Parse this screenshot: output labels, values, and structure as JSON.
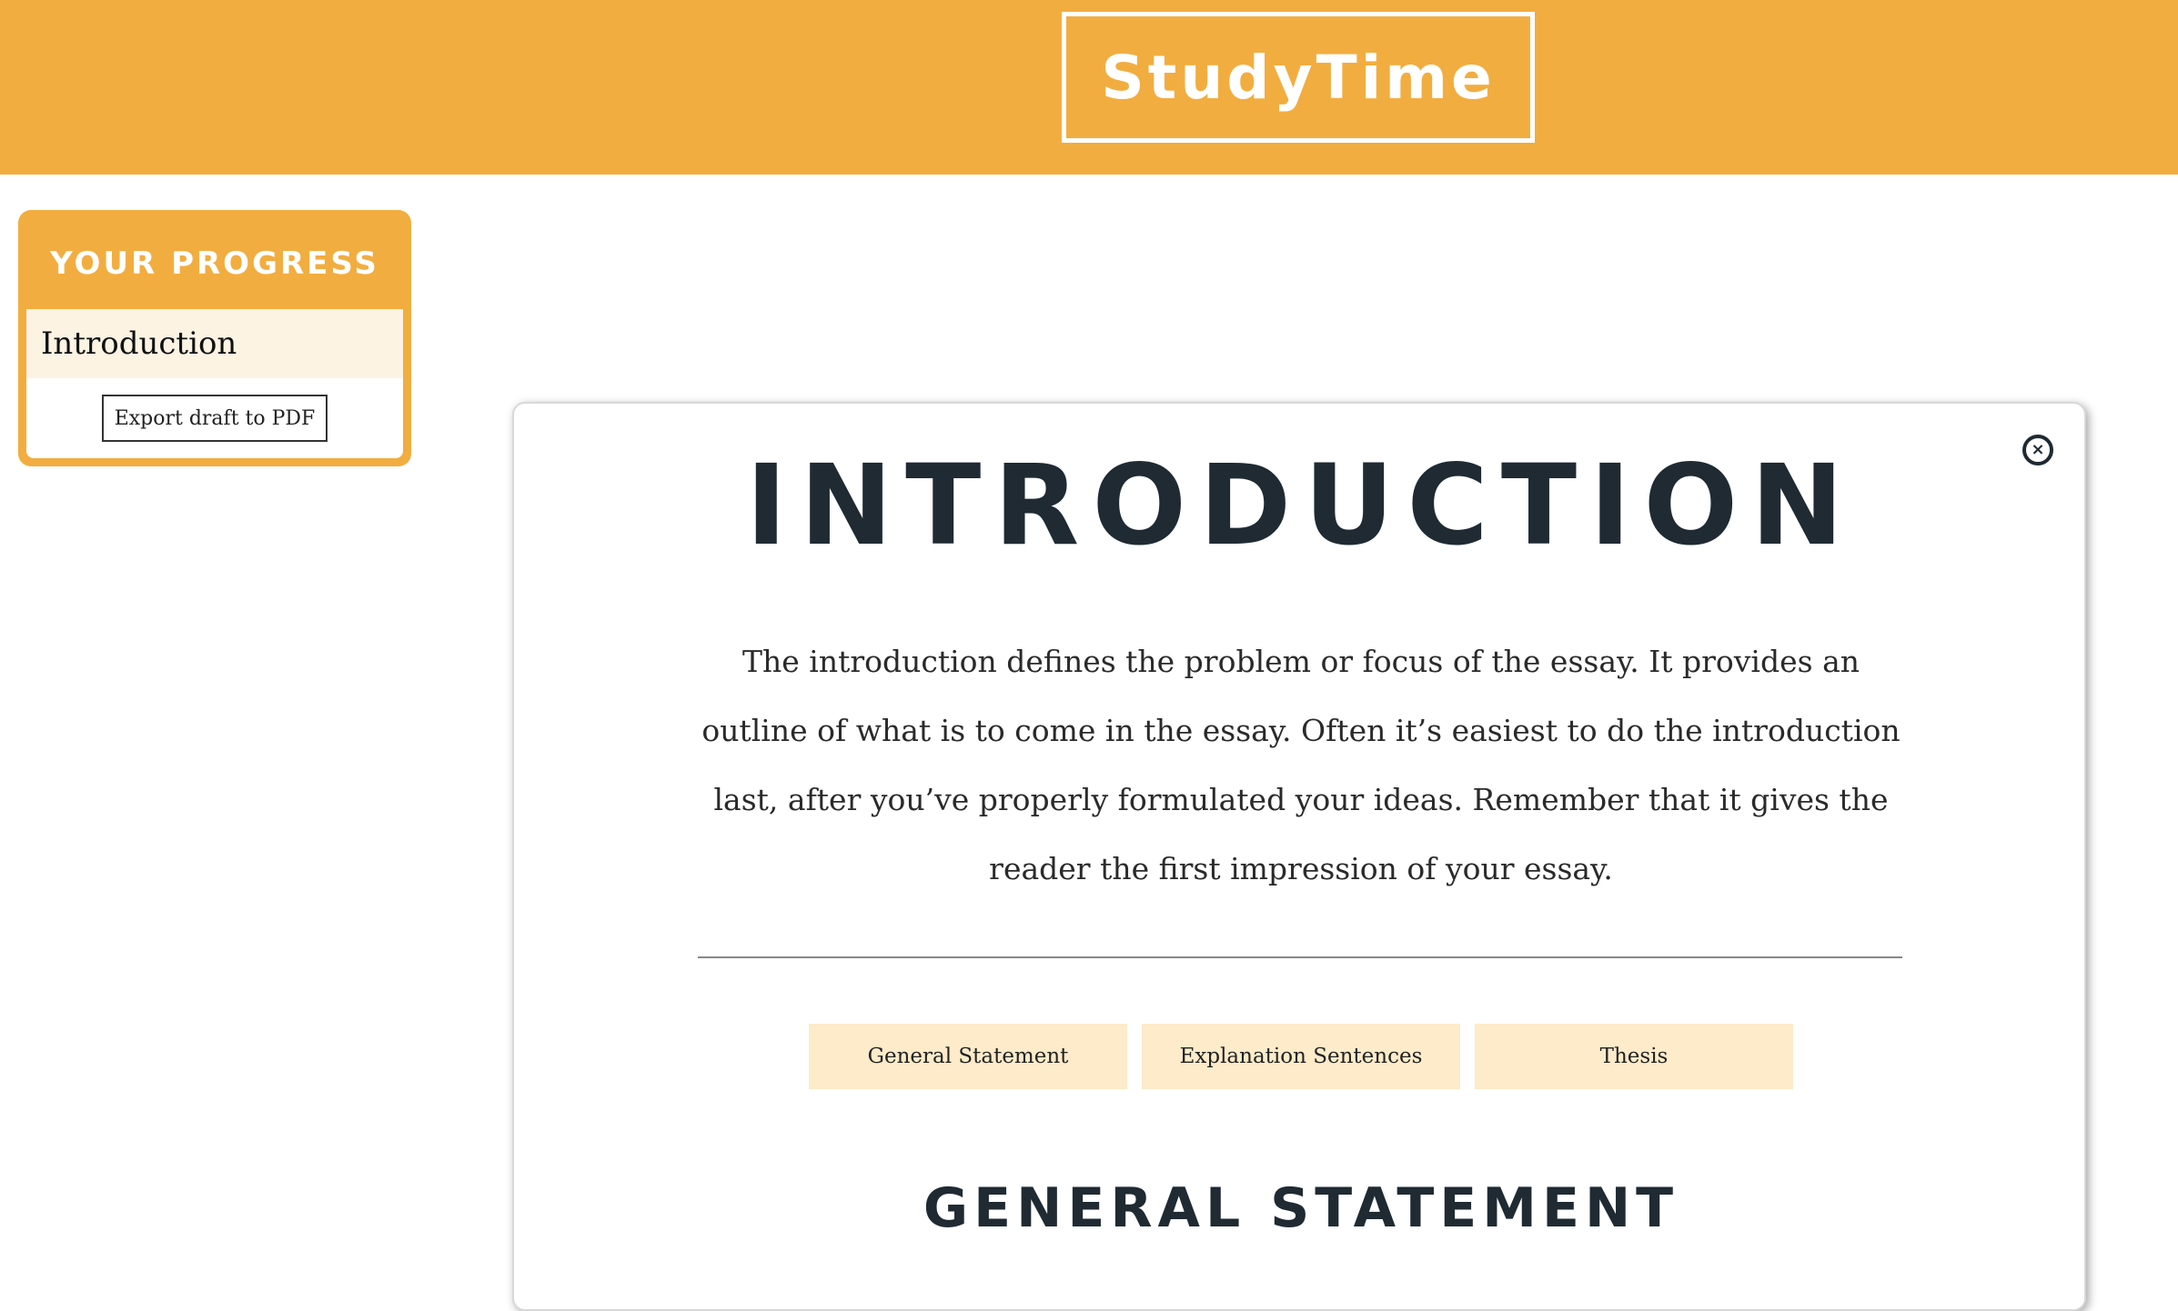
{
  "header": {
    "logo_text": "StudyTime"
  },
  "progress": {
    "title": "YOUR PROGRESS",
    "items": [
      {
        "label": "Introduction"
      }
    ],
    "export_label": "Export draft to PDF"
  },
  "card": {
    "title": "INTRODUCTION",
    "description": "The introduction defines the problem or focus of the essay. It provides an outline of what is to come in the essay. Often it’s easiest to do the introduction last, after you’ve properly formulated your ideas. Remember that it gives the reader the first impression of your essay.",
    "close_icon": "close-circle-icon",
    "tabs": [
      {
        "label": "General Statement"
      },
      {
        "label": "Explanation Sentences"
      },
      {
        "label": "Thesis"
      }
    ],
    "section_title": "GENERAL STATEMENT"
  },
  "colors": {
    "brand": "#f2ad40",
    "tab_background": "#fdebc9",
    "active_item_background": "#fdf3e3",
    "heading_text": "#1f2a33"
  }
}
